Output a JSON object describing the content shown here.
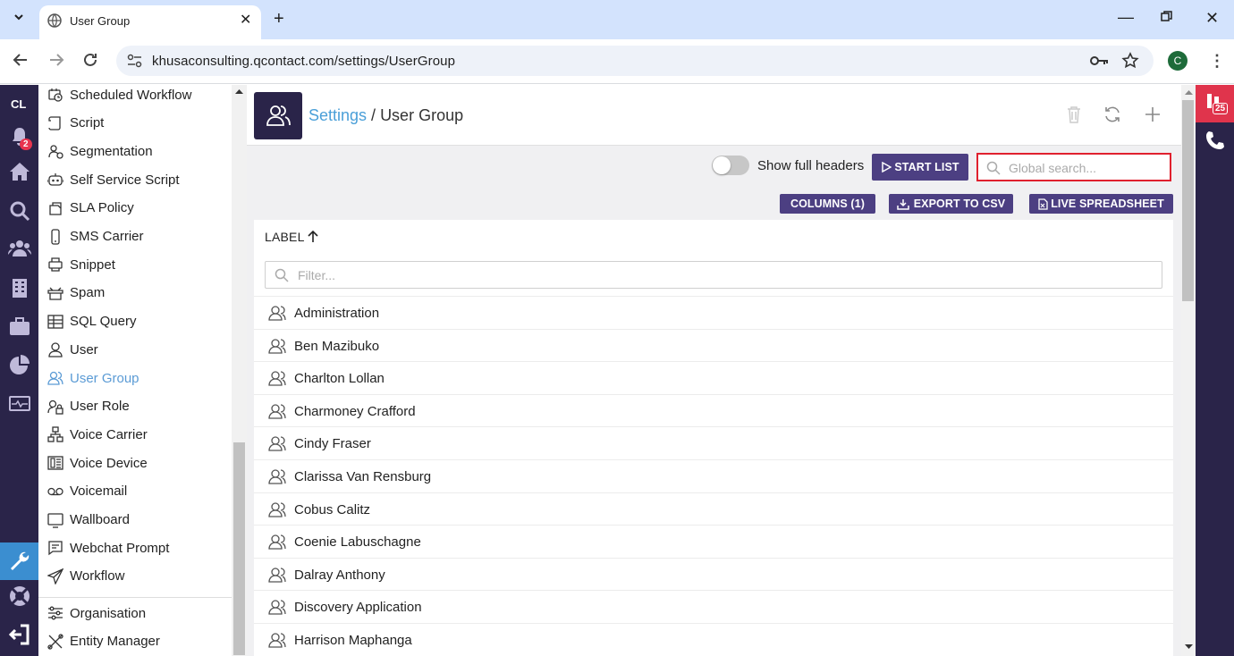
{
  "browser": {
    "tab_title": "User Group",
    "url": "khusaconsulting.qcontact.com/settings/UserGroup",
    "profile_initial": "C"
  },
  "rail": {
    "initials": "CL",
    "notification_count": "2",
    "right_badge": "25"
  },
  "settings_list": {
    "items": [
      {
        "label": "Scheduled Workflow",
        "icon": "scheduled-workflow-icon"
      },
      {
        "label": "Script",
        "icon": "script-icon"
      },
      {
        "label": "Segmentation",
        "icon": "segmentation-icon"
      },
      {
        "label": "Self Service Script",
        "icon": "robot-icon"
      },
      {
        "label": "SLA Policy",
        "icon": "sla-icon"
      },
      {
        "label": "SMS Carrier",
        "icon": "phone-icon"
      },
      {
        "label": "Snippet",
        "icon": "snippet-icon"
      },
      {
        "label": "Spam",
        "icon": "spam-icon"
      },
      {
        "label": "SQL Query",
        "icon": "table-icon"
      },
      {
        "label": "User",
        "icon": "user-icon"
      },
      {
        "label": "User Group",
        "icon": "users-icon"
      },
      {
        "label": "User Role",
        "icon": "user-role-icon"
      },
      {
        "label": "Voice Carrier",
        "icon": "network-icon"
      },
      {
        "label": "Voice Device",
        "icon": "device-icon"
      },
      {
        "label": "Voicemail",
        "icon": "voicemail-icon"
      },
      {
        "label": "Wallboard",
        "icon": "monitor-icon"
      },
      {
        "label": "Webchat Prompt",
        "icon": "chat-icon"
      },
      {
        "label": "Workflow",
        "icon": "send-icon"
      }
    ],
    "bottom_items": [
      {
        "label": "Organisation",
        "icon": "sliders-icon"
      },
      {
        "label": "Entity Manager",
        "icon": "tools-icon"
      }
    ],
    "selected": "User Group"
  },
  "header": {
    "crumb_link": "Settings",
    "crumb_separator": " / ",
    "crumb_current": "User Group"
  },
  "controls": {
    "toggle_label": "Show full headers",
    "start_list": "START LIST",
    "search_placeholder": "Global search...",
    "columns_btn": "COLUMNS (1)",
    "export_btn": "EXPORT TO CSV",
    "live_btn": "LIVE SPREADSHEET"
  },
  "table": {
    "column_header": "LABEL",
    "filter_placeholder": "Filter...",
    "rows": [
      "Administration",
      "Ben Mazibuko",
      "Charlton Lollan",
      "Charmoney Crafford",
      "Cindy Fraser",
      "Clarissa Van Rensburg",
      "Cobus Calitz",
      "Coenie Labuschagne",
      "Dalray Anthony",
      "Discovery Application",
      "Harrison Maphanga"
    ]
  },
  "colors": {
    "rail": "#2a2449",
    "accent": "#4c3f82",
    "link": "#4a9fd8",
    "highlight": "#e0202e"
  }
}
